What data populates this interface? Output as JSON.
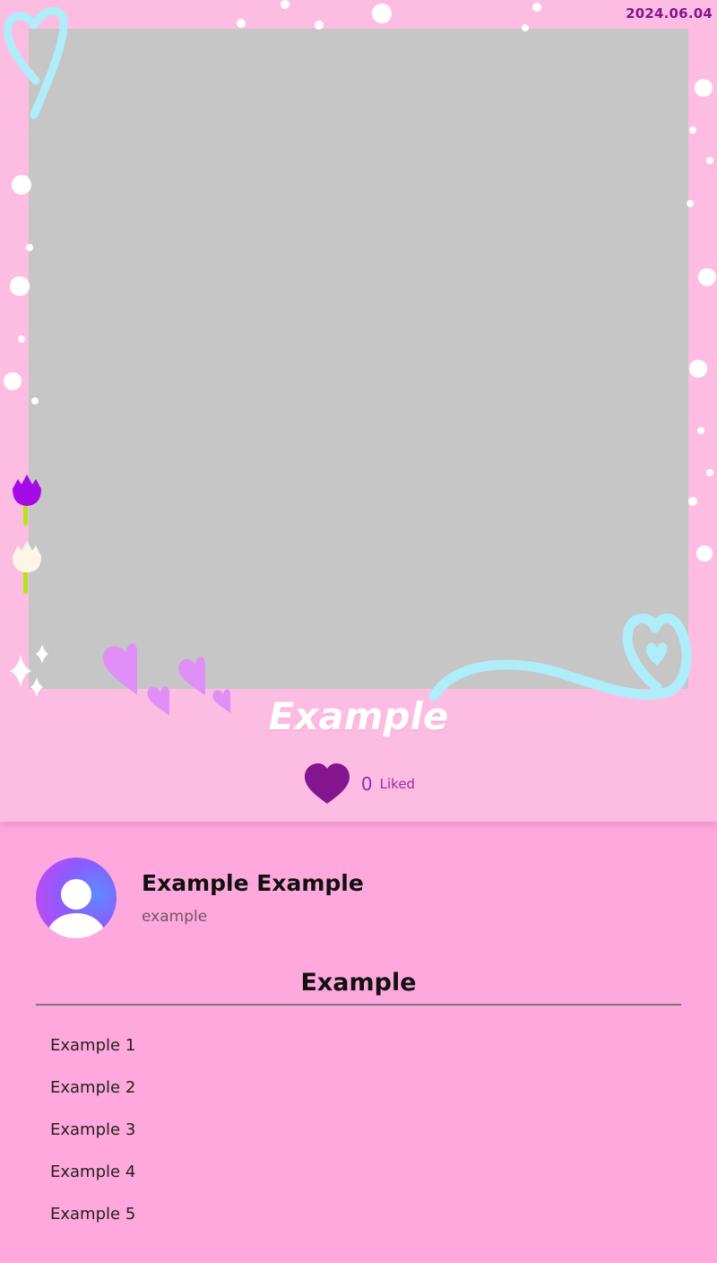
{
  "post": {
    "date": "2024.06.04",
    "title": "Example",
    "likes": {
      "count": "0",
      "label": "Liked"
    }
  },
  "profile": {
    "name": "Example Example",
    "handle": "example"
  },
  "section": {
    "title": "Example",
    "items": [
      "Example 1",
      "Example 2",
      "Example 3",
      "Example 4",
      "Example 5"
    ]
  },
  "colors": {
    "background": "#ffa8dd",
    "card": "#fdbde3",
    "photo_placeholder": "#c6c6c6",
    "accent": "#85158f",
    "heart_outline": "#aeeefa",
    "small_hearts": "#df8ff7"
  }
}
